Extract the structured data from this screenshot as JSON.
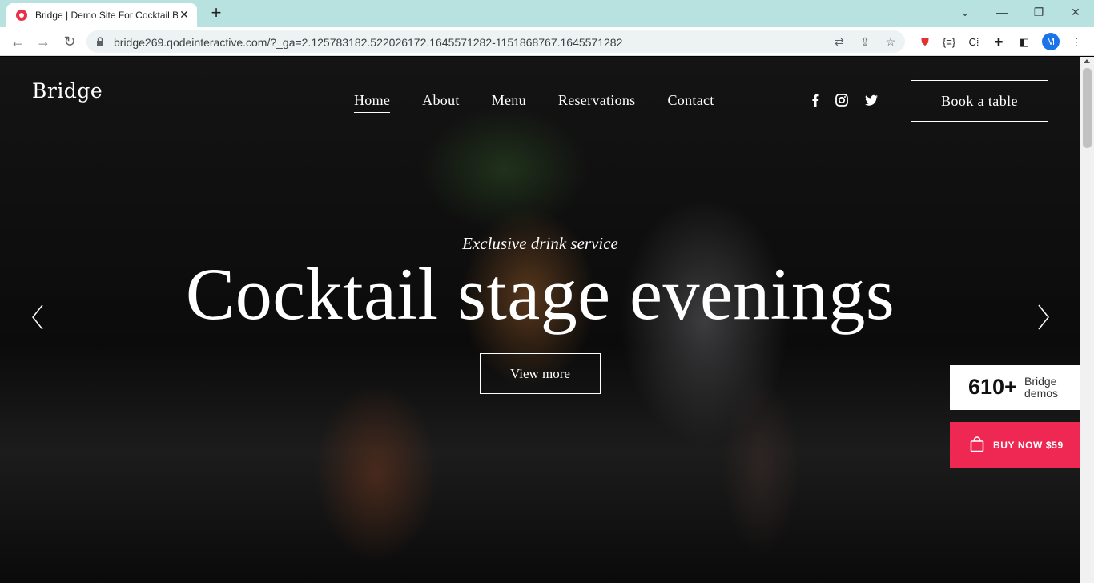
{
  "browser": {
    "tab_title": "Bridge | Demo Site For Cocktail B",
    "url": "bridge269.qodeinteractive.com/?_ga=2.125783182.522026172.1645571282-1151868767.1645571282",
    "profile_initial": "M"
  },
  "header": {
    "logo": "Bridge",
    "nav": [
      "Home",
      "About",
      "Menu",
      "Reservations",
      "Contact"
    ],
    "active_nav": "Home",
    "book_button": "Book a table"
  },
  "hero": {
    "subtitle": "Exclusive drink service",
    "headline": "Cocktail stage evenings",
    "cta": "View more"
  },
  "promo": {
    "demos_count": "610+",
    "demos_label_1": "Bridge",
    "demos_label_2": "demos",
    "buy_label": "BUY NOW $59",
    "buy_color": "#ee2852"
  }
}
